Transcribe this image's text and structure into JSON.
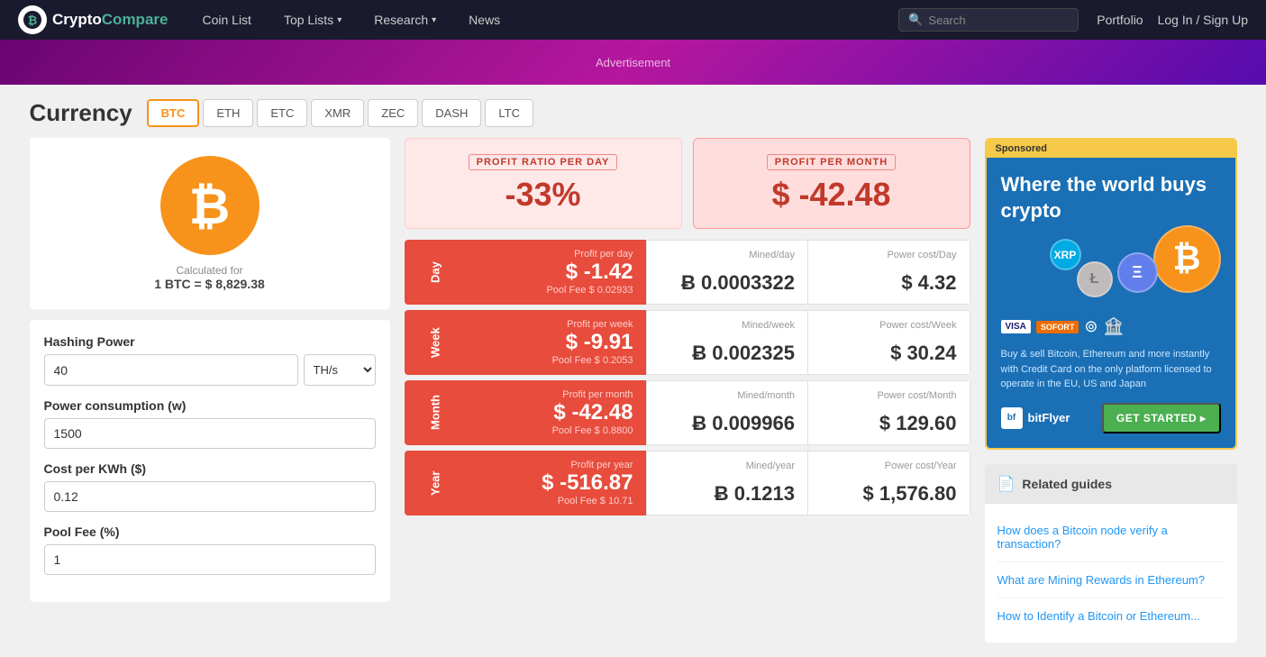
{
  "nav": {
    "logo_text1": "Crypto",
    "logo_text2": "Compare",
    "links": [
      {
        "label": "Coin List",
        "has_chevron": false
      },
      {
        "label": "Top Lists",
        "has_chevron": true
      },
      {
        "label": "Research",
        "has_chevron": true
      },
      {
        "label": "News",
        "has_chevron": false
      }
    ],
    "search_placeholder": "Search",
    "portfolio": "Portfolio",
    "login": "Log In / Sign Up"
  },
  "currency": {
    "title": "Currency",
    "tabs": [
      "BTC",
      "ETH",
      "ETC",
      "XMR",
      "ZEC",
      "DASH",
      "LTC"
    ],
    "active_tab": "BTC"
  },
  "coin": {
    "symbol": "₿",
    "calc_label": "Calculated for",
    "price_line": "1 BTC = $ 8,829.38"
  },
  "form": {
    "hashing_power_label": "Hashing Power",
    "hashing_power_value": "40",
    "hashing_unit": "TH/s",
    "power_consumption_label": "Power consumption (w)",
    "power_consumption_value": "1500",
    "cost_per_kwh_label": "Cost per KWh ($)",
    "cost_per_kwh_value": "0.12",
    "pool_fee_label": "Pool Fee (%)",
    "pool_fee_value": "1"
  },
  "profit_summary": {
    "daily_label": "PROFIT RATIO PER DAY",
    "daily_value": "-33%",
    "monthly_label": "PROFIT PER MONTH",
    "monthly_value": "$ -42.48"
  },
  "stats": [
    {
      "period": "Day",
      "profit_label": "Profit per day",
      "profit_value": "$ -1.42",
      "pool_fee": "Pool Fee $ 0.02933",
      "mined_label": "Mined/day",
      "mined_value": "Ƀ 0.0003322",
      "power_label": "Power cost/Day",
      "power_value": "$ 4.32"
    },
    {
      "period": "Week",
      "profit_label": "Profit per week",
      "profit_value": "$ -9.91",
      "pool_fee": "Pool Fee $ 0.2053",
      "mined_label": "Mined/week",
      "mined_value": "Ƀ 0.002325",
      "power_label": "Power cost/Week",
      "power_value": "$ 30.24"
    },
    {
      "period": "Month",
      "profit_label": "Profit per month",
      "profit_value": "$ -42.48",
      "pool_fee": "Pool Fee $ 0.8800",
      "mined_label": "Mined/month",
      "mined_value": "Ƀ 0.009966",
      "power_label": "Power cost/Month",
      "power_value": "$ 129.60"
    },
    {
      "period": "Year",
      "profit_label": "Profit per year",
      "profit_value": "$ -516.87",
      "pool_fee": "Pool Fee $ 10.71",
      "mined_label": "Mined/year",
      "mined_value": "Ƀ 0.1213",
      "power_label": "Power cost/Year",
      "power_value": "$ 1,576.80"
    }
  ],
  "ad": {
    "sponsored_label": "Sponsored",
    "headline": "Where the world buys crypto",
    "description": "Buy & sell Bitcoin, Ethereum and more instantly with Credit Card on the only platform licensed to operate in the EU, US and Japan",
    "brand": "bitFlyer",
    "cta": "GET STARTED ▸"
  },
  "related_guides": {
    "section_label": "Related guides",
    "items": [
      "How does a Bitcoin node verify a transaction?",
      "What are Mining Rewards in Ethereum?",
      "How to Identify a Bitcoin or Ethereum..."
    ]
  }
}
